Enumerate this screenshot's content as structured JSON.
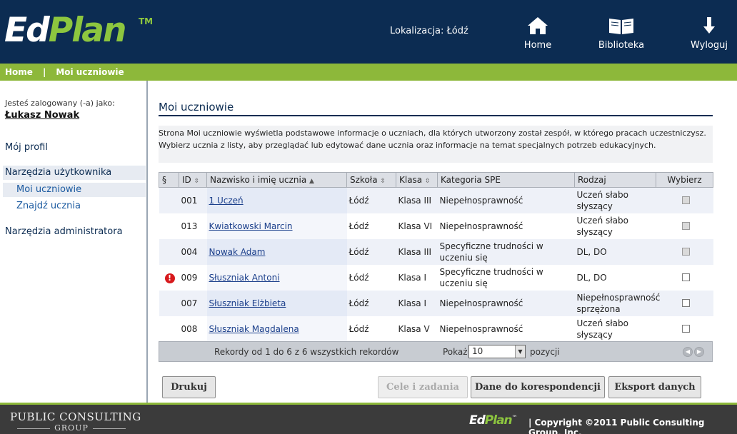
{
  "header": {
    "logo_ed": "Ed",
    "logo_plan": "Plan",
    "logo_tm": "TM",
    "location": "Lokalizacja: Łódź",
    "nav": {
      "home": "Home",
      "library": "Biblioteka",
      "logout": "Wyloguj"
    }
  },
  "breadcrumb": {
    "home": "Home",
    "separator": "|",
    "current": "Moi uczniowie"
  },
  "sidebar": {
    "logged_label": "Jesteś zalogowany (-a) jako:",
    "user_name": "Łukasz Nowak",
    "my_profile": "Mój profil",
    "user_tools": "Narzędzia użytkownika",
    "my_students": "Moi uczniowie",
    "find_student": "Znajdź ucznia",
    "admin_tools": "Narzędzia administratora"
  },
  "main": {
    "title": "Moi uczniowie",
    "description": "Strona Moi uczniowie wyświetla podstawowe informacje o uczniach, dla których utworzony został zespół, w którego pracach uczestniczysz. Wybierz ucznia z listy, aby przeglądać lub edytować dane ucznia oraz informacje na temat specjalnych potrzeb edukacyjnych."
  },
  "table": {
    "headers": {
      "flag": "§",
      "id": "ID",
      "name": "Nazwisko i imię ucznia",
      "school": "Szkoła",
      "class": "Klasa",
      "category": "Kategoria SPE",
      "type": "Rodzaj",
      "select": "Wybierz"
    },
    "rows": [
      {
        "alert": false,
        "id": "001",
        "name": "1 Uczeń",
        "school": "Łódź",
        "class": "Klasa III",
        "category": "Niepełnosprawność",
        "type": "Uczeń słabo słyszący",
        "checkbox_disabled": true
      },
      {
        "alert": false,
        "id": "013",
        "name": "Kwiatkowski Marcin",
        "school": "Łódź",
        "class": "Klasa VI",
        "category": "Niepełnosprawność",
        "type": "Uczeń słabo słyszący",
        "checkbox_disabled": true
      },
      {
        "alert": false,
        "id": "004",
        "name": "Nowak Adam",
        "school": "Łódź",
        "class": "Klasa III",
        "category": "Specyficzne trudności w uczeniu się",
        "type": "DL, DO",
        "checkbox_disabled": true
      },
      {
        "alert": true,
        "id": "009",
        "name": "Słuszniak Antoni",
        "school": "Łódź",
        "class": "Klasa I",
        "category": "Specyficzne trudności w uczeniu się",
        "type": "DL, DO",
        "checkbox_disabled": false
      },
      {
        "alert": false,
        "id": "007",
        "name": "Słuszniak Elżbieta",
        "school": "Łódź",
        "class": "Klasa I",
        "category": "Niepełnosprawność",
        "type": "Niepełnosprawność sprzężona",
        "checkbox_disabled": false
      },
      {
        "alert": false,
        "id": "008",
        "name": "Słuszniak Magdalena",
        "school": "Łódź",
        "class": "Klasa V",
        "category": "Niepełnosprawność",
        "type": "Uczeń słabo słyszący",
        "checkbox_disabled": false
      }
    ]
  },
  "pager": {
    "records": "Rekordy od 1 do 6 z 6 wszystkich rekordów",
    "show": "Pokaż",
    "page_size": "10",
    "per_page": "pozycji"
  },
  "buttons": {
    "print": "Drukuj",
    "goals": "Cele i zadania",
    "contact": "Dane do korespondencji",
    "export": "Eksport danych"
  },
  "footer": {
    "company": "PUBLIC CONSULTING",
    "group": "GROUP",
    "logo_ed": "Ed",
    "logo_plan": "Plan",
    "logo_tm": "™",
    "copyright": "|  Copyright ©2011 Public Consulting Group, Inc."
  },
  "colors": {
    "header_bg": "#0c2c52",
    "accent_green": "#8db83a",
    "footer_bg": "#3b3b3b",
    "alert_red": "#d7191c"
  },
  "icons": {
    "home": "home-icon",
    "library": "book-icon",
    "logout": "arrow-down-icon",
    "alert": "alert-icon"
  }
}
